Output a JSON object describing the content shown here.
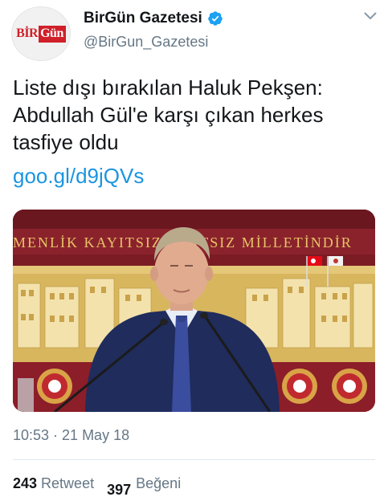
{
  "account": {
    "name": "BirGün Gazetesi",
    "handle": "@BirGun_Gazetesi",
    "avatar_logo": {
      "part1": "BİR",
      "part2": "Gün"
    },
    "verified_icon": "verified-badge-icon",
    "menu_icon": "chevron-down-icon"
  },
  "tweet": {
    "text_lines": [
      "Liste dışı bırakılan Haluk Pekşen:",
      "Abdullah Gül'e karşı çıkan herkes",
      "tasfiye oldu"
    ],
    "link": "goo.gl/d9jQVs"
  },
  "media": {
    "wall_inscription": "MENLİK KAYITSIZ ŞARTSIZ MİLLETİNDİR"
  },
  "meta": {
    "timestamp": "10:53 · 21 May 18"
  },
  "stats": {
    "retweets_count": "243",
    "retweets_label": "Retweet",
    "likes_count": "397",
    "likes_label": "Beğeni"
  },
  "colors": {
    "text": "#14171a",
    "secondary": "#657786",
    "link": "#1b95e0",
    "verified": "#1da1f2",
    "brand_red": "#d0202a"
  }
}
